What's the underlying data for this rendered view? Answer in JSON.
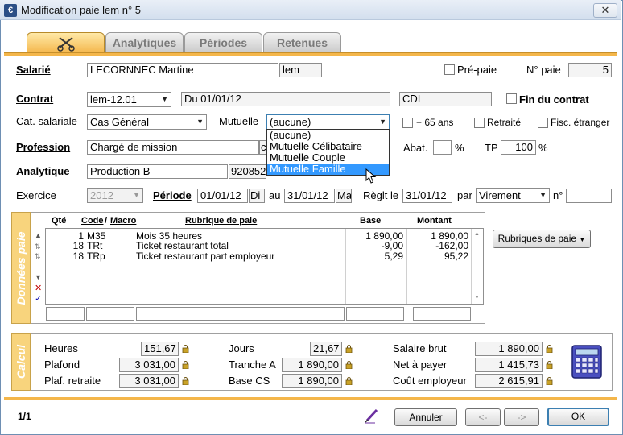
{
  "window": {
    "title": "Modification paie lem n° 5",
    "close_symbol": "✕",
    "app_icon_glyph": "€"
  },
  "tabs": [
    {
      "label": "",
      "icon": "scissors-icon",
      "active": true
    },
    {
      "label": "Analytiques"
    },
    {
      "label": "Périodes"
    },
    {
      "label": "Retenues"
    }
  ],
  "salarie": {
    "label": "Salarié",
    "name": "LECORNNEC Martine",
    "code": "lem",
    "pre_paie_label": "Pré-paie",
    "no_paie_label": "N° paie",
    "no_paie": "5"
  },
  "contrat": {
    "label": "Contrat",
    "value": "lem-12.01",
    "date": "Du 01/01/12",
    "type": "CDI",
    "fin_label": "Fin du contrat"
  },
  "cat": {
    "label": "Cat. salariale",
    "value": "Cas Général",
    "mutuelle_label": "Mutuelle",
    "mutuelle_value": "(aucune)",
    "plus65_label": "+ 65 ans",
    "retraite_label": "Retraité",
    "fisc_label": "Fisc. étranger"
  },
  "mutuelle_options": [
    "(aucune)",
    "Mutuelle Célibataire",
    "Mutuelle Couple",
    "Mutuelle Famille"
  ],
  "profession": {
    "label": "Profession",
    "value": "Chargé de mission",
    "extra": "c",
    "abat_label": "Abat.",
    "abat_value": "",
    "pct": "%",
    "tp_label": "TP",
    "tp_value": "100",
    "tp_pct": "%"
  },
  "analytique": {
    "label": "Analytique",
    "value": "Production B",
    "code": "920852"
  },
  "exercice": {
    "label": "Exercice",
    "value": "2012",
    "periode_label": "Période",
    "from": "01/01/12",
    "from_day": "Di",
    "au_label": "au",
    "to": "31/01/12",
    "to_day": "Ma",
    "reglt_label": "Règlt le",
    "reglt_date": "31/01/12",
    "par_label": "par",
    "par_value": "Virement",
    "no_label": "n°",
    "no_value": ""
  },
  "donnees": {
    "title": "Données paie",
    "headers": {
      "qte": "Qté",
      "code": "Code",
      "macro": "Macro",
      "rubrique": "Rubrique de paie",
      "base": "Base",
      "montant": "Montant"
    },
    "rows": [
      {
        "qte": "1",
        "code": "M35",
        "rubrique": "Mois 35 heures",
        "base": "1 890,00",
        "montant": "1 890,00"
      },
      {
        "qte": "18",
        "code": "TRt",
        "rubrique": "Ticket restaurant total",
        "base": "-9,00",
        "montant": "-162,00"
      },
      {
        "qte": "18",
        "code": "TRp",
        "rubrique": "Ticket restaurant part employeur",
        "base": "5,29",
        "montant": "95,22"
      }
    ],
    "rubriques_button": "Rubriques de paie"
  },
  "calcul": {
    "title": "Calcul",
    "heures_label": "Heures",
    "heures": "151,67",
    "plafond_label": "Plafond",
    "plafond": "3 031,00",
    "plaf_retraite_label": "Plaf. retraite",
    "plaf_retraite": "3 031,00",
    "jours_label": "Jours",
    "jours": "21,67",
    "tranche_a_label": "Tranche A",
    "tranche_a": "1 890,00",
    "base_cs_label": "Base CS",
    "base_cs": "1 890,00",
    "salaire_brut_label": "Salaire brut",
    "salaire_brut": "1 890,00",
    "net_label": "Net à payer",
    "net": "1 415,73",
    "cout_label": "Coût employeur",
    "cout": "2 615,91"
  },
  "footer": {
    "page": "1/1",
    "annuler": "Annuler",
    "prev": "<-",
    "next": "->",
    "ok": "OK"
  }
}
